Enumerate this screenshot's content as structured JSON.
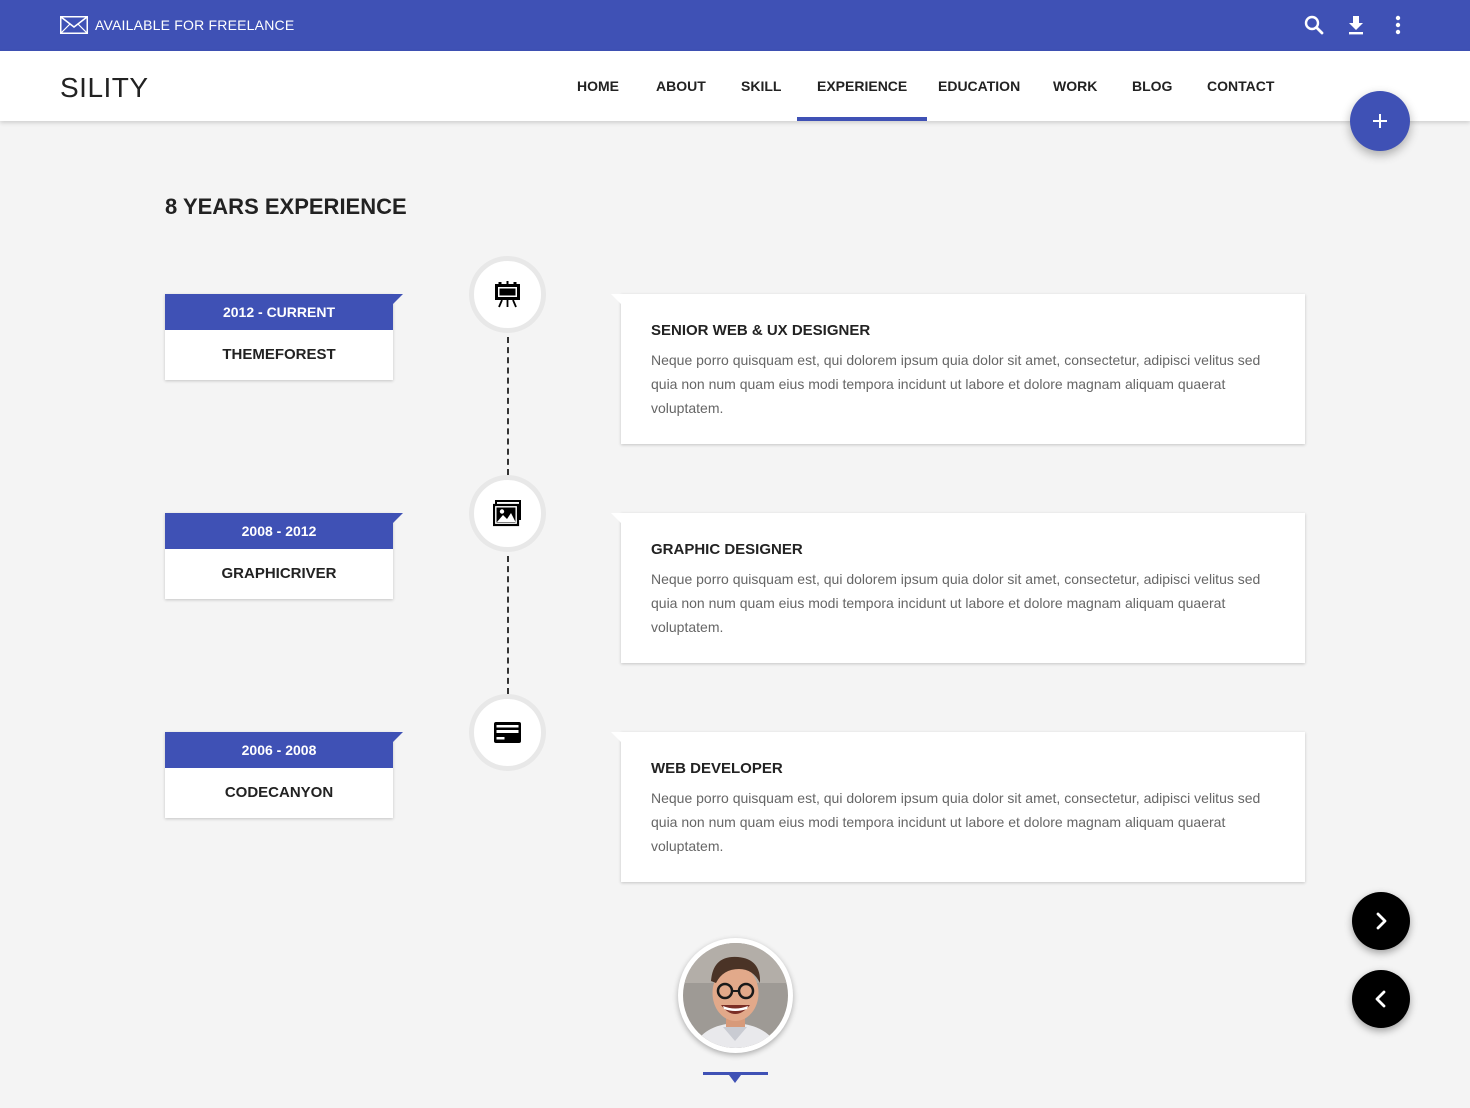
{
  "topbar": {
    "freelance_text": "AVAILABLE FOR FREELANCE",
    "icons": [
      "mail-icon",
      "search-icon",
      "download-icon",
      "more-vert-icon"
    ]
  },
  "header": {
    "logo": "SILITY",
    "nav": [
      {
        "label": "HOME",
        "active": false
      },
      {
        "label": "ABOUT",
        "active": false
      },
      {
        "label": "SKILL",
        "active": false
      },
      {
        "label": "EXPERIENCE",
        "active": true
      },
      {
        "label": "EDUCATION",
        "active": false
      },
      {
        "label": "WORK",
        "active": false
      },
      {
        "label": "BLOG",
        "active": false
      },
      {
        "label": "CONTACT",
        "active": false
      }
    ]
  },
  "main": {
    "title": "8 YEARS EXPERIENCE",
    "timeline": [
      {
        "date": "2012 - CURRENT",
        "company": "THEMEFOREST",
        "icon": "easel-icon",
        "job_title": "SENIOR WEB & UX DESIGNER",
        "description": "Neque porro quisquam est, qui dolorem ipsum quia dolor sit amet, consectetur, adipisci velitus sed quia non num quam eius modi tempora incidunt ut labore et dolore magnam aliquam quaerat voluptatem."
      },
      {
        "date": "2008 - 2012",
        "company": "GRAPHICRIVER",
        "icon": "photos-icon",
        "job_title": "GRAPHIC DESIGNER",
        "description": "Neque porro quisquam est, qui dolorem ipsum quia dolor sit amet, consectetur, adipisci velitus sed quia non num quam eius modi tempora incidunt ut labore et dolore magnam aliquam quaerat voluptatem."
      },
      {
        "date": "2006 - 2008",
        "company": "CODECANYON",
        "icon": "credit-card-icon",
        "job_title": "WEB DEVELOPER",
        "description": "Neque porro quisquam est, qui dolorem ipsum quia dolor sit amet, consectetur, adipisci velitus sed quia non num quam eius modi tempora incidunt ut labore et dolore magnam aliquam quaerat voluptatem."
      }
    ]
  },
  "colors": {
    "primary": "#3f51b5",
    "background": "#f4f4f4",
    "text": "#222222",
    "muted_text": "#666666"
  }
}
